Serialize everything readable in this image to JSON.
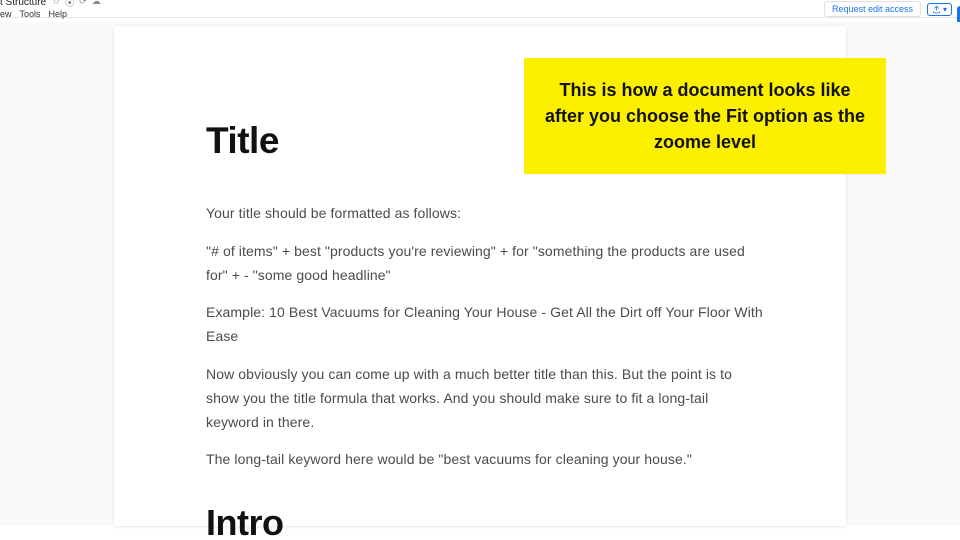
{
  "header": {
    "doc_title": "t Structure",
    "menu": {
      "view": "ew",
      "tools": "Tools",
      "help": "Help"
    },
    "request_btn": "Request edit access"
  },
  "annotation": {
    "text": "This is how a document looks like after you choose the Fit option as the zoome level"
  },
  "doc": {
    "h1_title": "Title",
    "p1": "Your title should be formatted as follows:",
    "p2": "\"# of items\" + best \"products you're reviewing\" + for \"something the products are used for\" + - \"some good headline\"",
    "p3": "Example: 10 Best Vacuums for Cleaning Your House - Get All the Dirt off Your Floor With Ease",
    "p4": "Now obviously you can come up with a much better title than this. But the point is to show you the title formula that works. And you should make sure to fit a long-tail keyword in there.",
    "p5": "The long-tail keyword here would be \"best vacuums for cleaning your house.\"",
    "h1_intro": "Intro"
  }
}
